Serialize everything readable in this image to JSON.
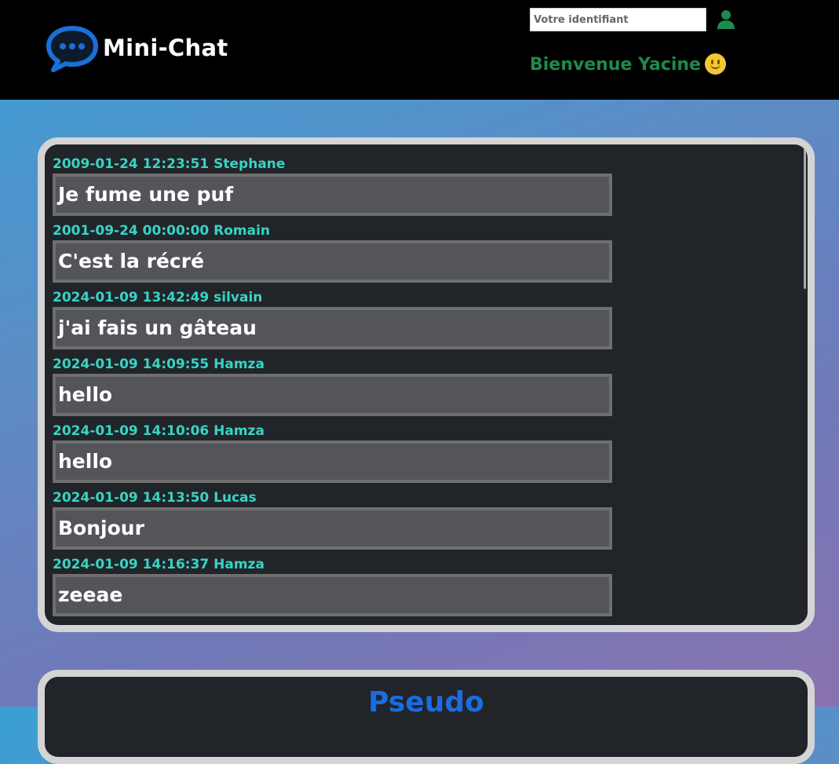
{
  "header": {
    "brand": "Mini-Chat",
    "logo_icon": "chat-bubble-icon",
    "id_placeholder": "Votre identifiant",
    "user_icon": "user-icon",
    "welcome": "Bienvenue Yacine",
    "welcome_emoji_icon": "smiley-icon",
    "welcome_color": "#1e8a4b"
  },
  "messages": [
    {
      "meta": "2009-01-24 12:23:51 Stephane",
      "text": "Je fume une puf"
    },
    {
      "meta": "2001-09-24 00:00:00 Romain",
      "text": "C'est la récré"
    },
    {
      "meta": "2024-01-09 13:42:49 silvain",
      "text": "j'ai fais un gâteau"
    },
    {
      "meta": "2024-01-09 14:09:55 Hamza",
      "text": "hello"
    },
    {
      "meta": "2024-01-09 14:10:06 Hamza",
      "text": "hello"
    },
    {
      "meta": "2024-01-09 14:13:50 Lucas",
      "text": "Bonjour"
    },
    {
      "meta": "2024-01-09 14:16:37 Hamza",
      "text": "zeeae"
    }
  ],
  "form": {
    "pseudo_label": "Pseudo"
  },
  "colors": {
    "meta": "#38d4c4",
    "bubble_bg": "#54555a",
    "panel_bg": "#212429",
    "accent_blue": "#1a6ce0"
  }
}
